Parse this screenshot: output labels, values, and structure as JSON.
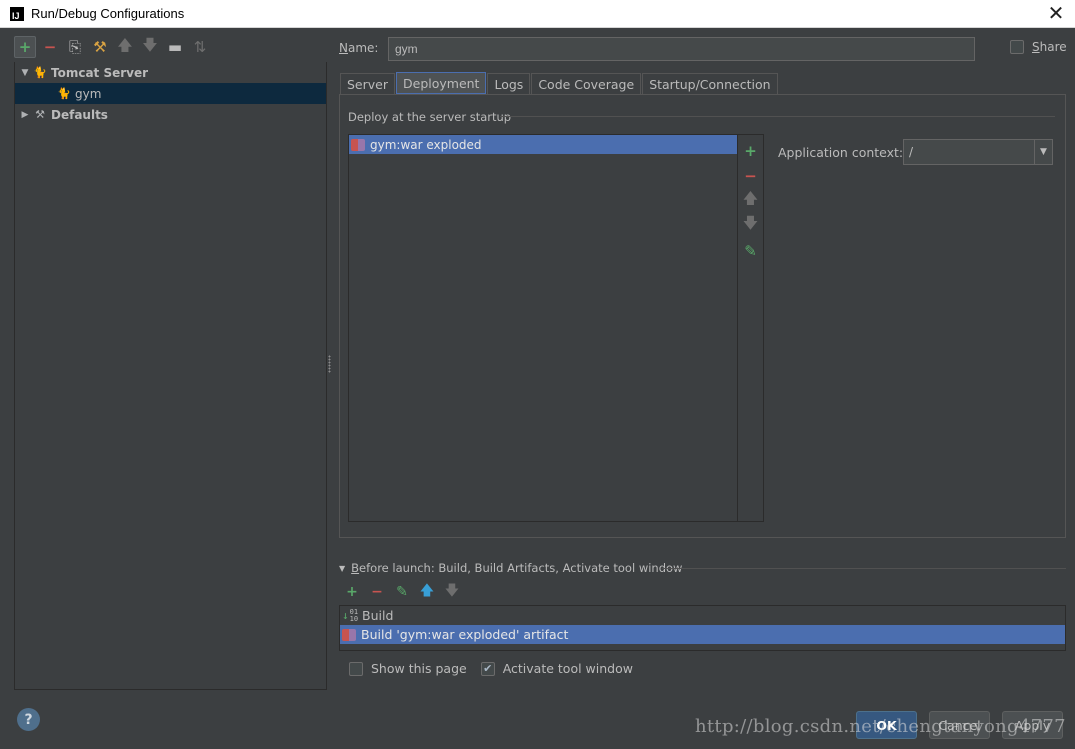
{
  "window": {
    "title": "Run/Debug Configurations",
    "app_icon_text": "IJ"
  },
  "left_toolbar": {
    "buttons": [
      {
        "name": "add",
        "glyph": "+"
      },
      {
        "name": "remove",
        "glyph": "−"
      },
      {
        "name": "copy",
        "glyph": "⎘"
      },
      {
        "name": "edit-defaults",
        "glyph": "⚒"
      },
      {
        "name": "move-up",
        "glyph": "🡅"
      },
      {
        "name": "move-down",
        "glyph": "🡇"
      },
      {
        "name": "folder",
        "glyph": "▬"
      },
      {
        "name": "sort",
        "glyph": "⇅"
      }
    ]
  },
  "tree": {
    "items": [
      {
        "label": "Tomcat Server",
        "expanded": true,
        "level": 0,
        "bold": true
      },
      {
        "label": "gym",
        "level": 1,
        "selected": true
      },
      {
        "label": "Defaults",
        "expanded": false,
        "level": 0,
        "bold": true
      }
    ]
  },
  "name_field": {
    "label_prefix": "N",
    "label_rest": "ame:",
    "value": "gym"
  },
  "share": {
    "label_prefix": "S",
    "label_rest": "hare",
    "checked": false
  },
  "tabs": [
    {
      "label": "Server",
      "active": false
    },
    {
      "label": "Deployment",
      "active": true
    },
    {
      "label": "Logs",
      "active": false
    },
    {
      "label": "Code Coverage",
      "active": false
    },
    {
      "label": "Startup/Connection",
      "active": false
    }
  ],
  "deployment": {
    "section_title": "Deploy at the server startup",
    "artifacts": [
      "gym:war exploded"
    ],
    "application_context_label": "Application context:",
    "application_context_value": "/",
    "tools": [
      "+",
      "−",
      "🡅",
      "🡇",
      "✎"
    ]
  },
  "before_launch": {
    "header_prefix": "B",
    "header_rest": "efore launch: Build, Build Artifacts, Activate tool window",
    "toolbar": [
      "+",
      "−",
      "✎",
      "🡅",
      "🡇"
    ],
    "items": [
      {
        "label": "Build",
        "selected": false
      },
      {
        "label": "Build 'gym:war exploded' artifact",
        "selected": true
      }
    ]
  },
  "options": {
    "show_this_page": {
      "label": "Show this page",
      "checked": false
    },
    "activate_tool_window": {
      "label": "Activate tool window",
      "checked": true
    }
  },
  "buttons": {
    "help": "?",
    "ok": "OK",
    "cancel": "Cancel",
    "apply": "Apply"
  },
  "watermark": "http://blog.csdn.net/chengtanyong4777",
  "colors": {
    "background": "#3c3f41",
    "selection": "#4b6eaf",
    "tree_selection": "#0d293e",
    "add_green": "#59a869",
    "remove_red": "#c75450",
    "ok_button": "#365880"
  }
}
